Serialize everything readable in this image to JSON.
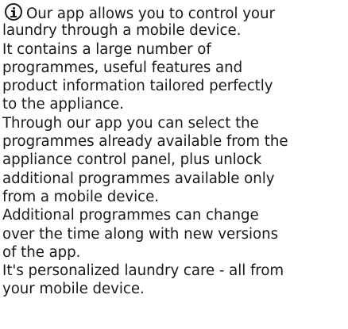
{
  "info_note": {
    "icon": "info-icon",
    "lines": [
      "Our app allows you to control your",
      "laundry through a mobile device.",
      "It contains a large number of",
      "programmes, useful features and",
      "product information tailored perfectly",
      "to the appliance.",
      "Through our app you can select the",
      "programmes already available from the",
      "appliance control panel, plus unlock",
      "additional programmes available only",
      "from a mobile device.",
      "Additional programmes can change",
      "over the time along with new versions",
      "of the app.",
      "It's personalized laundry care - all from",
      "your mobile device."
    ]
  }
}
